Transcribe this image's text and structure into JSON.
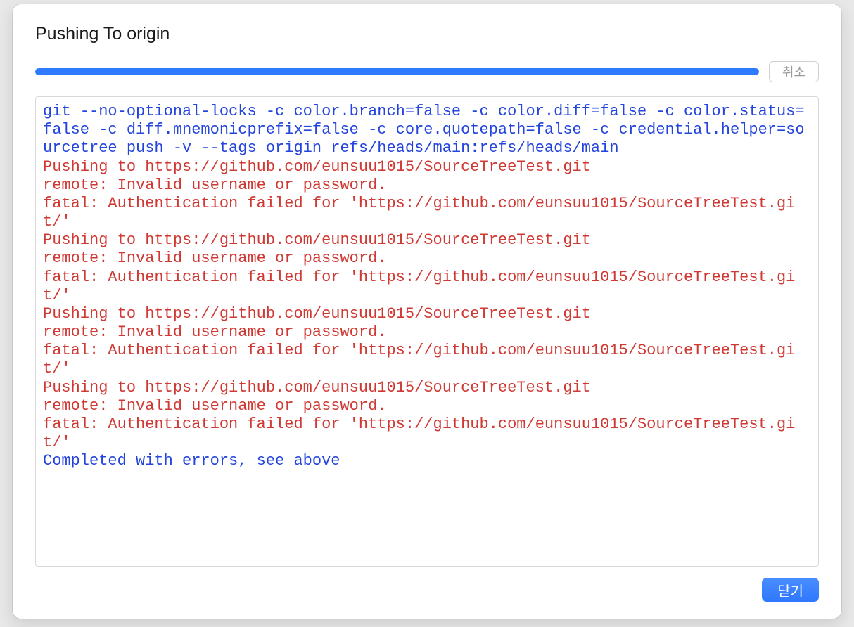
{
  "dialog": {
    "title": "Pushing To origin",
    "cancel_label": "취소",
    "close_label": "닫기"
  },
  "output": {
    "command": "git --no-optional-locks -c color.branch=false -c color.diff=false -c color.status=false -c diff.mnemonicprefix=false -c core.quotepath=false -c credential.helper=sourcetree push -v --tags origin refs/heads/main:refs/heads/main",
    "errors": [
      "Pushing to https://github.com/eunsuu1015/SourceTreeTest.git",
      "remote: Invalid username or password.",
      "fatal: Authentication failed for 'https://github.com/eunsuu1015/SourceTreeTest.git/'",
      "Pushing to https://github.com/eunsuu1015/SourceTreeTest.git",
      "remote: Invalid username or password.",
      "fatal: Authentication failed for 'https://github.com/eunsuu1015/SourceTreeTest.git/'",
      "Pushing to https://github.com/eunsuu1015/SourceTreeTest.git",
      "remote: Invalid username or password.",
      "fatal: Authentication failed for 'https://github.com/eunsuu1015/SourceTreeTest.git/'",
      "Pushing to https://github.com/eunsuu1015/SourceTreeTest.git",
      "remote: Invalid username or password.",
      "fatal: Authentication failed for 'https://github.com/eunsuu1015/SourceTreeTest.git/'"
    ],
    "completion": "Completed with errors, see above"
  }
}
